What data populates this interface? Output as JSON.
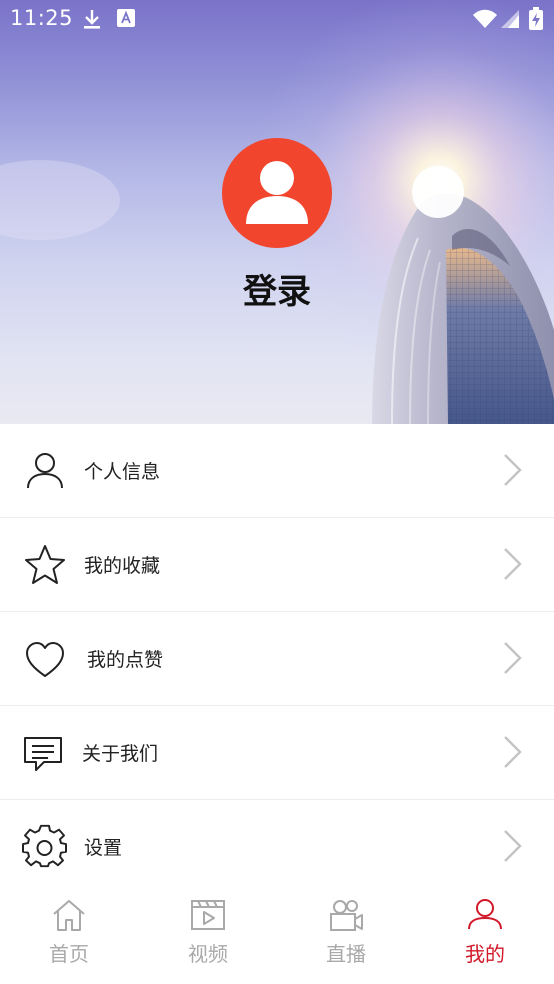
{
  "status_bar": {
    "time": "11:25",
    "icons": [
      "download-icon",
      "notification-a-icon",
      "wifi-icon",
      "signal-icon",
      "battery-charging-icon"
    ]
  },
  "profile": {
    "avatar_icon": "user-icon",
    "avatar_color": "#f1452d",
    "login_label": "登录"
  },
  "menu": {
    "items": [
      {
        "label": "个人信息",
        "icon": "user-icon"
      },
      {
        "label": "我的收藏",
        "icon": "star-icon"
      },
      {
        "label": "我的点赞",
        "icon": "heart-icon"
      },
      {
        "label": "关于我们",
        "icon": "message-icon"
      },
      {
        "label": "设置",
        "icon": "gear-icon"
      }
    ],
    "arrow_icon": "chevron-right-icon"
  },
  "tabbar": {
    "active_color": "#d2192a",
    "inactive_color": "#a9a9a9",
    "tabs": [
      {
        "label": "首页",
        "icon": "home-icon",
        "active": false
      },
      {
        "label": "视频",
        "icon": "video-icon",
        "active": false
      },
      {
        "label": "直播",
        "icon": "camera-icon",
        "active": false
      },
      {
        "label": "我的",
        "icon": "user-icon",
        "active": true
      }
    ]
  }
}
